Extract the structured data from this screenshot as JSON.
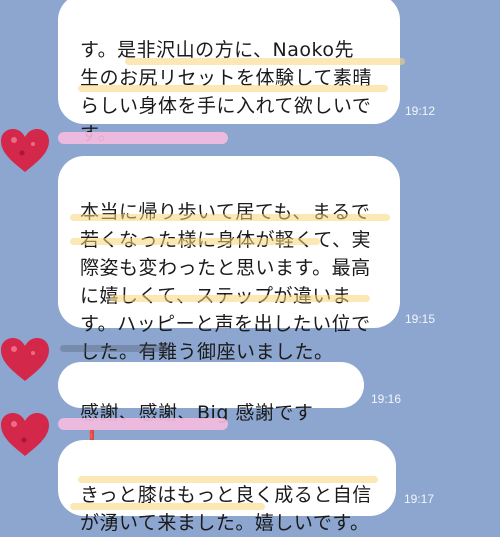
{
  "colors": {
    "background": "#8da6cf",
    "bubble": "#ffffff",
    "highlight": "#fad678",
    "avatar_red": "#d4284a",
    "name_pink": "#f6bde0"
  },
  "messages": [
    {
      "text": "す。是非沢山の方に、Naoko先\n生のお尻リセットを体験して素晴\nらしい身体を手に入れて欲しいで\nす。",
      "time": "19:12"
    },
    {
      "text": "本当に帰り歩いて居ても、まるで\n若くなった様に身体が軽くて、実\n際姿も変わったと思います。最高\nに嬉しくて、ステップが違いま\nす。ハッピーと声を出したい位で\nした。有難う御座いました。",
      "time": "19:15"
    },
    {
      "text": "感謝、感謝、Big 感謝です",
      "emoji": "❗",
      "time": "19:16"
    },
    {
      "text": "きっと膝はもっと良く成ると自信\nが湧いて来ました。嬉しいです。",
      "time": "19:17"
    }
  ],
  "icons": {
    "avatar": "heart-avatar-icon",
    "emoji": "red-exclamation-icon"
  }
}
